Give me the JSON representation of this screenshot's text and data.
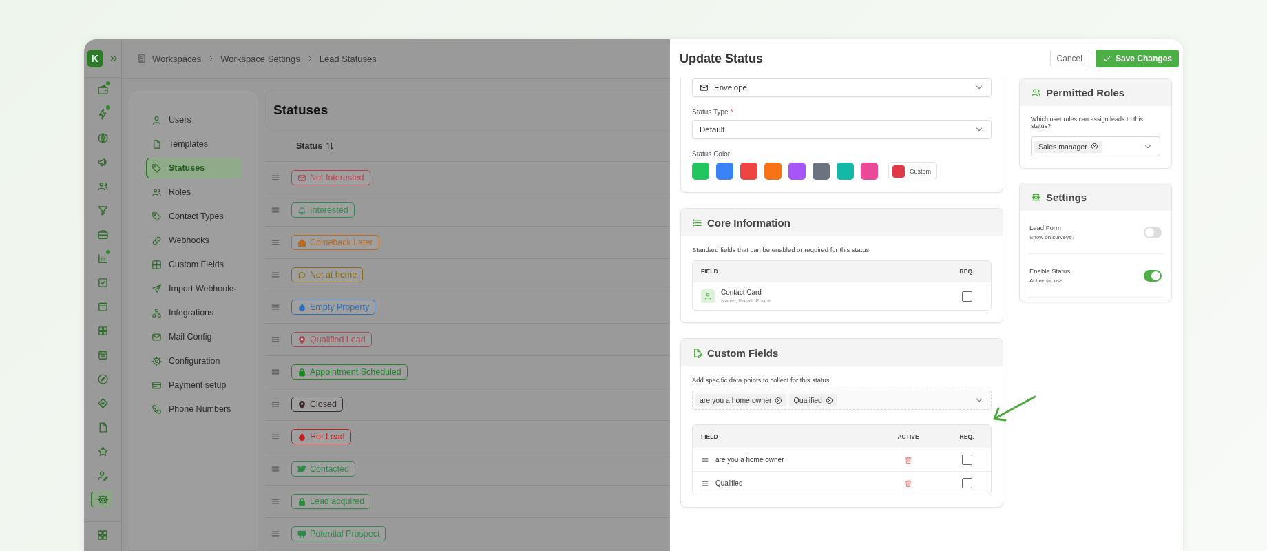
{
  "rail": {
    "logo": "K",
    "items": [
      {
        "dot": true,
        "selected": false
      },
      {
        "dot": true,
        "selected": false
      },
      {
        "dot": false,
        "selected": false
      },
      {
        "dot": false,
        "selected": false
      },
      {
        "dot": false,
        "selected": false
      },
      {
        "dot": false,
        "selected": false
      },
      {
        "dot": false,
        "selected": false
      },
      {
        "dot": true,
        "selected": false
      },
      {
        "dot": false,
        "selected": false
      },
      {
        "dot": false,
        "selected": false
      },
      {
        "dot": false,
        "selected": false
      },
      {
        "dot": false,
        "selected": false
      },
      {
        "dot": false,
        "selected": false
      },
      {
        "dot": false,
        "selected": false
      },
      {
        "dot": false,
        "selected": false
      },
      {
        "dot": false,
        "selected": false
      },
      {
        "dot": false,
        "selected": false
      },
      {
        "dot": false,
        "selected": true
      }
    ]
  },
  "breadcrumb": [
    "Workspaces",
    "Workspace Settings",
    "Lead Statuses"
  ],
  "settings_nav": [
    {
      "label": "Users",
      "selected": false
    },
    {
      "label": "Templates",
      "selected": false
    },
    {
      "label": "Statuses",
      "selected": true
    },
    {
      "label": "Roles",
      "selected": false
    },
    {
      "label": "Contact Types",
      "selected": false
    },
    {
      "label": "Webhooks",
      "selected": false
    },
    {
      "label": "Custom Fields",
      "selected": false
    },
    {
      "label": "Import Webhooks",
      "selected": false
    },
    {
      "label": "Integrations",
      "selected": false
    },
    {
      "label": "Mail Config",
      "selected": false
    },
    {
      "label": "Configuration",
      "selected": false
    },
    {
      "label": "Payment setup",
      "selected": false
    },
    {
      "label": "Phone Numbers",
      "selected": false
    }
  ],
  "statuses": {
    "title": "Statuses",
    "column": "Status",
    "rows": [
      {
        "label": "Not Interested",
        "color": "#b8404a"
      },
      {
        "label": "Interested",
        "color": "#2f8a4e"
      },
      {
        "label": "Comeback Later",
        "color": "#b86a22"
      },
      {
        "label": "Not at home",
        "color": "#8a6a10"
      },
      {
        "label": "Empty Property",
        "color": "#2f6fb8"
      },
      {
        "label": "Qualified Lead",
        "color": "#a84a52"
      },
      {
        "label": "Appointment Scheduled",
        "color": "#1a8a20"
      },
      {
        "label": "Closed",
        "color": "#3a2c2c"
      },
      {
        "label": "Hot Lead",
        "color": "#c01c1c"
      },
      {
        "label": "Contacted",
        "color": "#2e8a4a"
      },
      {
        "label": "Lead acquired",
        "color": "#2e8a40"
      },
      {
        "label": "Potential Prospect",
        "color": "#2e8a4a"
      }
    ]
  },
  "panel": {
    "title": "Update Status",
    "cancel": "Cancel",
    "save": "Save Changes",
    "icon_select": {
      "value": "Envelope"
    },
    "status_type": {
      "label": "Status Type",
      "required_mark": "*",
      "value": "Default"
    },
    "status_color": {
      "label": "Status Color",
      "swatches": [
        {
          "color": "#22c55e"
        },
        {
          "color": "#3b82f6"
        },
        {
          "color": "#ef4444"
        },
        {
          "color": "#f97316"
        },
        {
          "color": "#a855f7"
        },
        {
          "color": "#6b7280"
        },
        {
          "color": "#14b8a6"
        },
        {
          "color": "#ec4899"
        }
      ],
      "custom": {
        "label": "Custom",
        "color": "#e03a48"
      }
    },
    "core": {
      "title": "Core Information",
      "description": "Standard fields that can be enabled or required for this status.",
      "columns": [
        "FIELD",
        "REQ."
      ],
      "rows": [
        {
          "name": "Contact Card",
          "detail": "Name, Email, Phone",
          "required": false
        }
      ]
    },
    "custom": {
      "title": "Custom Fields",
      "description": "Add specific data points to collect for this status.",
      "chips": [
        "are you a home owner",
        "Qualified"
      ],
      "columns": [
        "FIELD",
        "ACTIVE",
        "REQ."
      ],
      "rows": [
        {
          "name": "are you a home owner",
          "required": false
        },
        {
          "name": "Qualified",
          "required": false
        }
      ]
    },
    "roles": {
      "title": "Permitted Roles",
      "description": "Which user roles can assign leads to this status?",
      "chips": [
        "Sales manager"
      ]
    },
    "settings": {
      "title": "Settings",
      "toggles": [
        {
          "label": "Lead Form",
          "hint": "Show on surveys?",
          "on": false
        },
        {
          "label": "Enable Status",
          "hint": "Active for use",
          "on": true
        }
      ]
    }
  }
}
